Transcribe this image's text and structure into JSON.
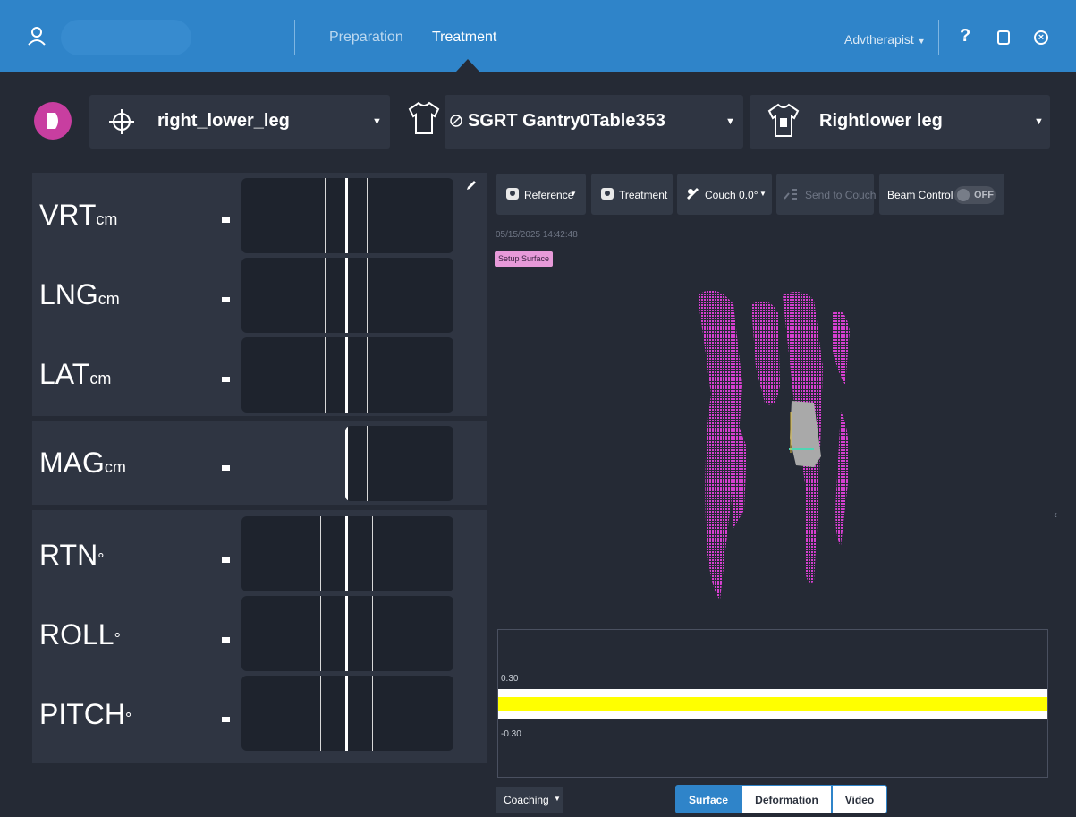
{
  "colors": {
    "topbar": "#2f84c9",
    "accent_magenta": "#c83ea0",
    "surface_cloud": "#d63fd0",
    "chart_band": "#ffff00",
    "segment_active": "#2f84c9"
  },
  "topbar": {
    "tabs": [
      {
        "label": "Preparation",
        "active": false
      },
      {
        "label": "Treatment",
        "active": true
      }
    ],
    "user_menu": "Advtherapist",
    "help": "?",
    "icons": [
      "user-icon",
      "tablet-icon",
      "close-circle-icon"
    ]
  },
  "selectors": {
    "target": {
      "icon": "crosshair-icon",
      "label": "right_lower_leg"
    },
    "plan": {
      "icon": "body-outline-icon",
      "label": "SGRT Gantry0Table353",
      "prefix_icon": "blocked-icon"
    },
    "region": {
      "icon": "body-region-icon",
      "label": "Rightlower leg"
    }
  },
  "metrics": [
    {
      "name": "VRT",
      "unit": "cm",
      "value": "-"
    },
    {
      "name": "LNG",
      "unit": "cm",
      "value": "-"
    },
    {
      "name": "LAT",
      "unit": "cm",
      "value": "-"
    },
    {
      "name": "MAG",
      "unit": "cm",
      "value": "-"
    },
    {
      "name": "RTN",
      "unit": "°",
      "value": "-"
    },
    {
      "name": "ROLL",
      "unit": "°",
      "value": "-"
    },
    {
      "name": "PITCH",
      "unit": "°",
      "value": "-"
    }
  ],
  "toolbar": {
    "reference": "Reference",
    "treatment": "Treatment",
    "couch": "Couch 0.0°",
    "send_to_couch": "Send to Couch",
    "beam_control": "Beam Control",
    "beam_state": "OFF"
  },
  "viewer": {
    "timestamp": "05/15/2025 14:42:48",
    "badge": "Setup Surface"
  },
  "chart_data": {
    "type": "line",
    "title": "",
    "y_tick_labels": [
      "0.30",
      "-0.30"
    ],
    "ylim": [
      -0.3,
      0.3
    ],
    "grid": false
  },
  "bottom": {
    "coaching": "Coaching",
    "segments": [
      {
        "label": "Surface",
        "active": true
      },
      {
        "label": "Deformation",
        "active": false
      },
      {
        "label": "Video",
        "active": false
      }
    ]
  }
}
